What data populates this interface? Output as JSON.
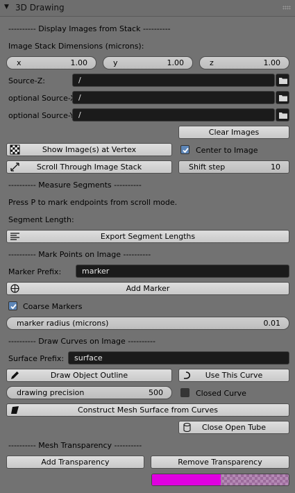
{
  "panel": {
    "title": "3D Drawing"
  },
  "display": {
    "heading": "---------- Display Images from Stack ----------",
    "dims_label": "Image Stack Dimensions (microns):",
    "x": {
      "label": "x",
      "value": "1.00"
    },
    "y": {
      "label": "y",
      "value": "1.00"
    },
    "z": {
      "label": "z",
      "value": "1.00"
    },
    "source_z": {
      "label": "Source-Z:",
      "value": "/"
    },
    "source_x": {
      "label": "optional Source-X:",
      "value": "/"
    },
    "source_y": {
      "label": "optional Source-Y:",
      "value": "/"
    },
    "clear_images": "Clear Images",
    "show_images": "Show Image(s) at Vertex",
    "center_to_image": "Center to Image",
    "center_checked": true,
    "scroll_stack": "Scroll Through Image Stack",
    "shift_step": {
      "label": "Shift step",
      "value": "10"
    }
  },
  "measure": {
    "heading": "---------- Measure Segments ----------",
    "hint": "Press P to mark endpoints from scroll mode.",
    "segment_length": "Segment Length:",
    "export": "Export Segment Lengths"
  },
  "markers": {
    "heading": "---------- Mark Points on Image ----------",
    "prefix_label": "Marker Prefix:",
    "prefix_value": "marker",
    "add_marker": "Add Marker",
    "coarse": "Coarse Markers",
    "coarse_checked": true,
    "radius": {
      "label": "marker radius (microns)",
      "value": "0.01"
    }
  },
  "curves": {
    "heading": "---------- Draw Curves on Image ----------",
    "surface_label": "Surface Prefix:",
    "surface_value": "surface",
    "draw_outline": "Draw Object Outline",
    "use_curve": "Use This Curve",
    "precision": {
      "label": "drawing precision",
      "value": "500"
    },
    "closed_curve": "Closed Curve",
    "closed_checked": false,
    "construct_mesh": "Construct Mesh Surface from Curves",
    "close_tube": "Close Open Tube"
  },
  "transparency": {
    "heading": "---------- Mesh Transparency ----------",
    "add": "Add Transparency",
    "remove": "Remove Transparency",
    "level": 0.5,
    "fill_color": "#e000e0"
  }
}
